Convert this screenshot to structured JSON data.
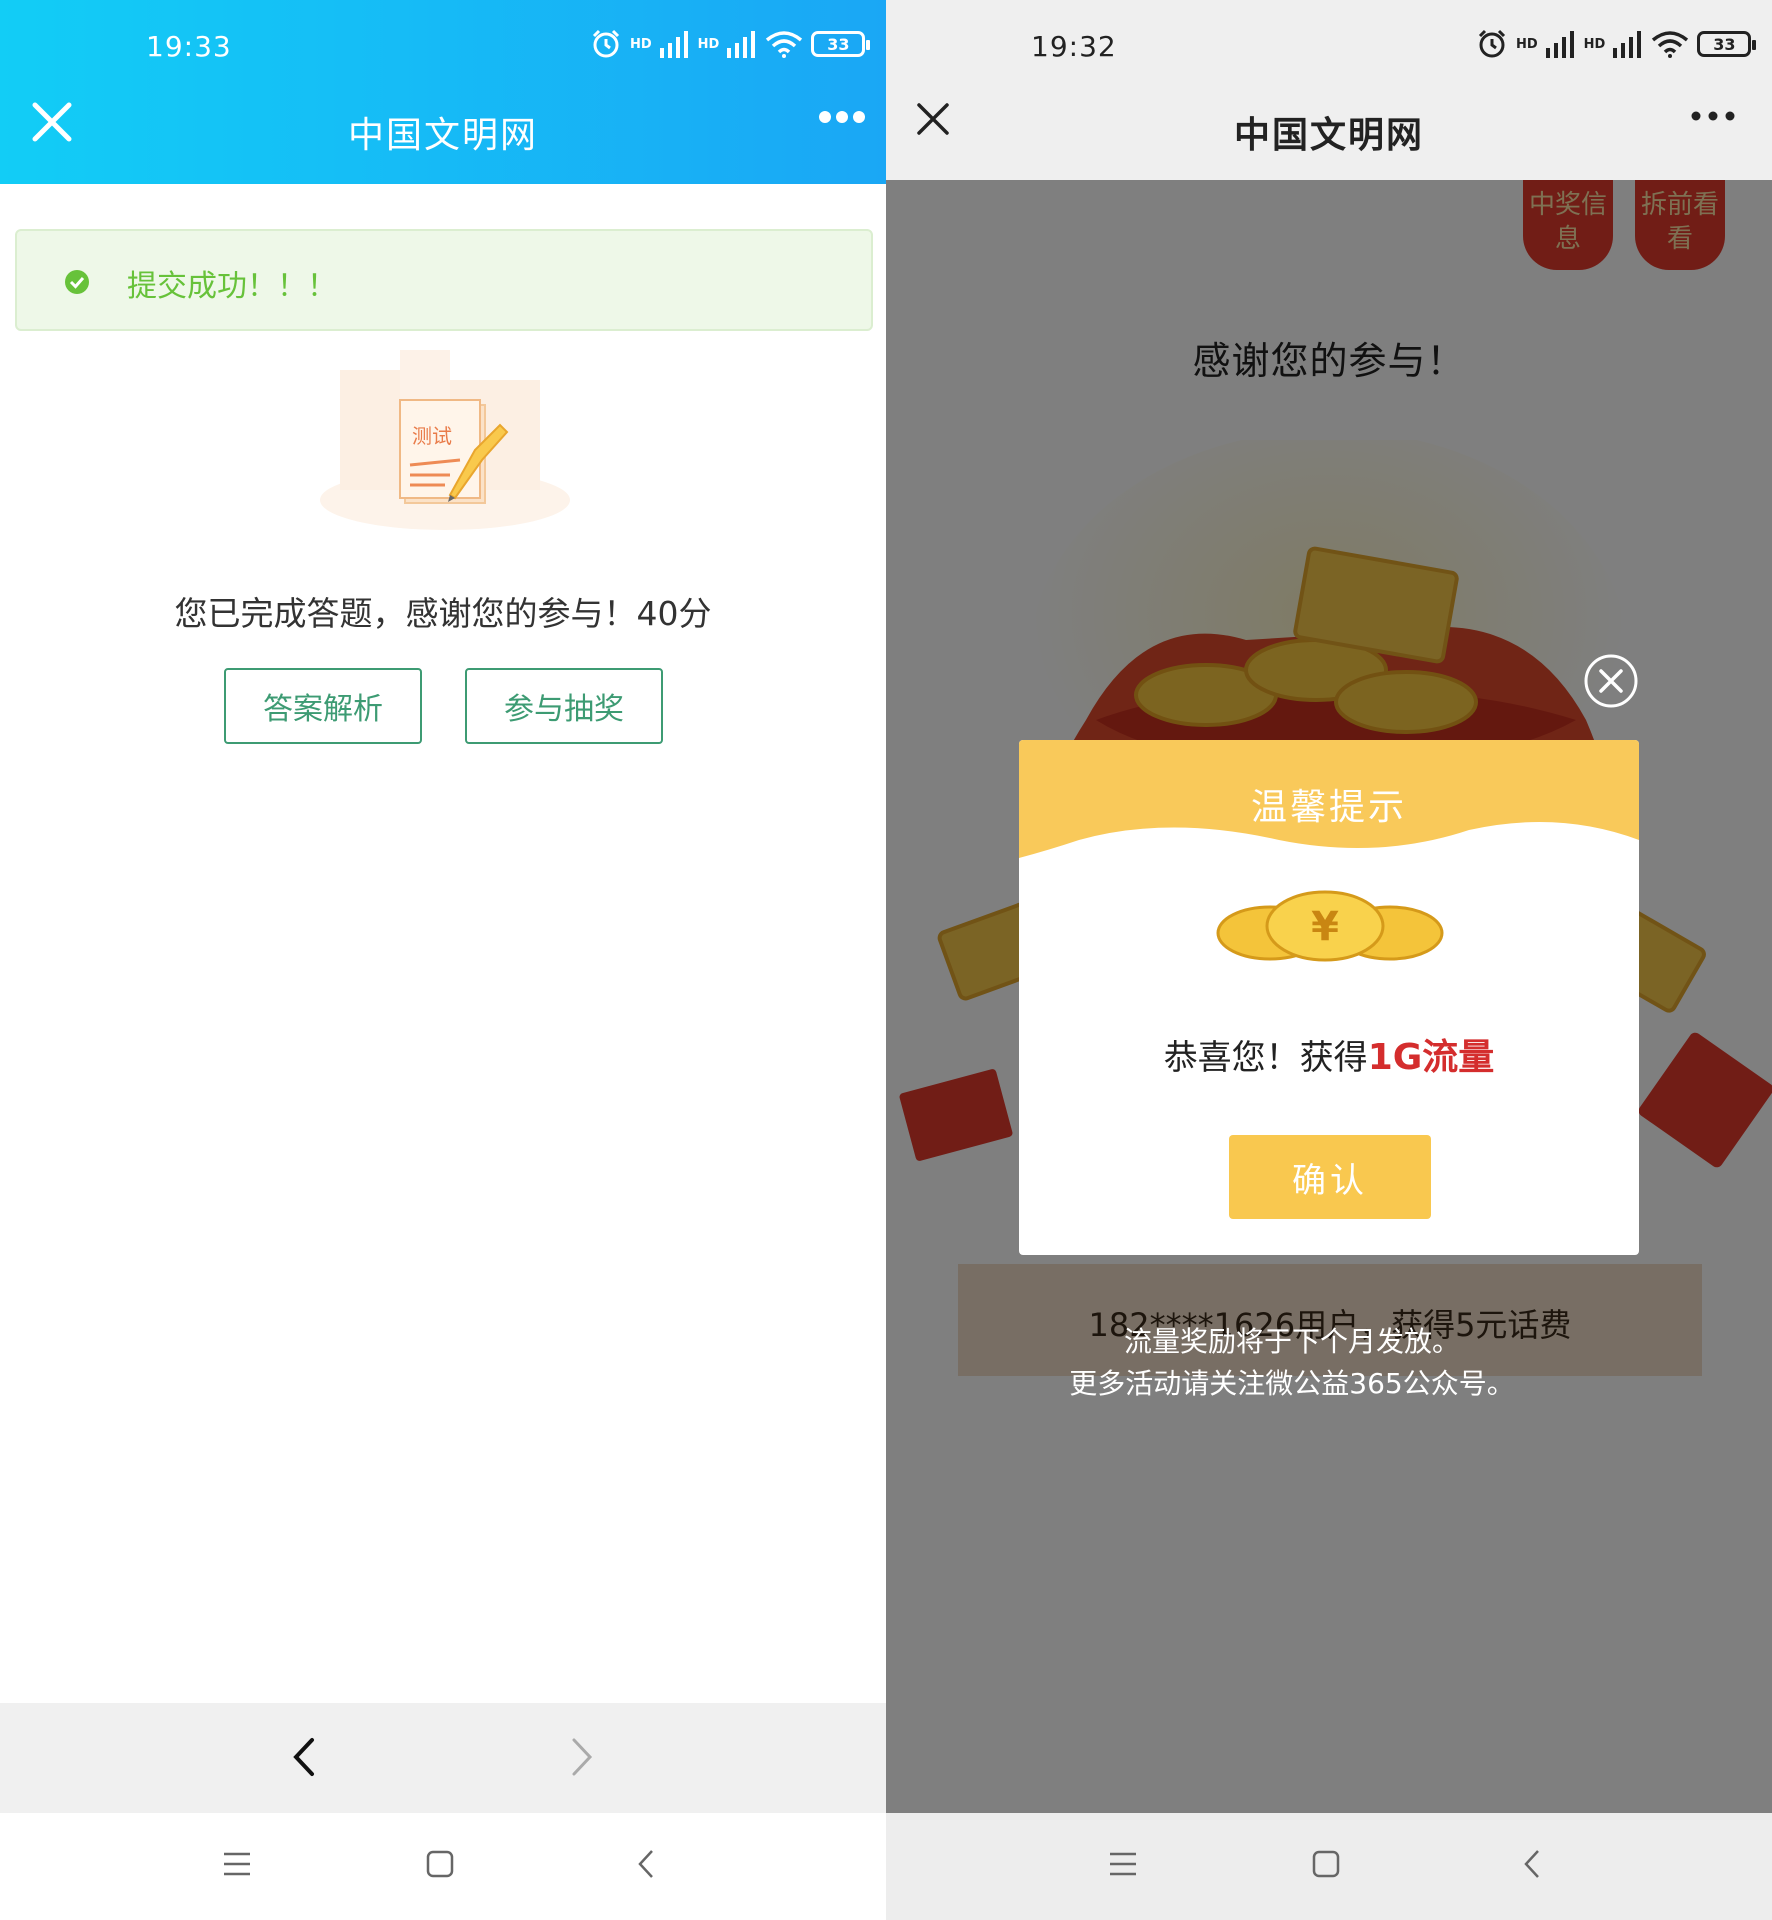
{
  "left": {
    "status": {
      "time": "19:33",
      "signal1": "HD",
      "signal2": "HD",
      "battery": "33"
    },
    "nav": {
      "title": "中国文明网"
    },
    "success_message": "提交成功！！！",
    "illustration_text": "测试",
    "result_text": "您已完成答题，感谢您的参与！40分",
    "buttons": {
      "answer": "答案解析",
      "draw": "参与抽奖"
    }
  },
  "right": {
    "status": {
      "time": "19:32",
      "signal1": "HD",
      "signal2": "HD",
      "battery": "33"
    },
    "nav": {
      "title": "中国文明网"
    },
    "tags": {
      "winners": "中奖信息",
      "preview": "拆前看看"
    },
    "thanks": "感谢您的参与！",
    "ticker": "182****1626用户，获得5元话费",
    "dialog": {
      "title": "温馨提示",
      "message_prefix": "恭喜您！获得",
      "prize": "1G流量",
      "confirm": "确认"
    },
    "notes": [
      "流量奖励将于下个月发放。",
      "更多活动请关注微公益365公众号。"
    ]
  },
  "colors": {
    "left_header_start": "#12cdf6",
    "left_header_end": "#1aa7f5",
    "success_green": "#67c23a",
    "button_green": "#3d9b73",
    "dialog_yellow": "#f9c84f",
    "prize_red": "#d42d2d"
  }
}
